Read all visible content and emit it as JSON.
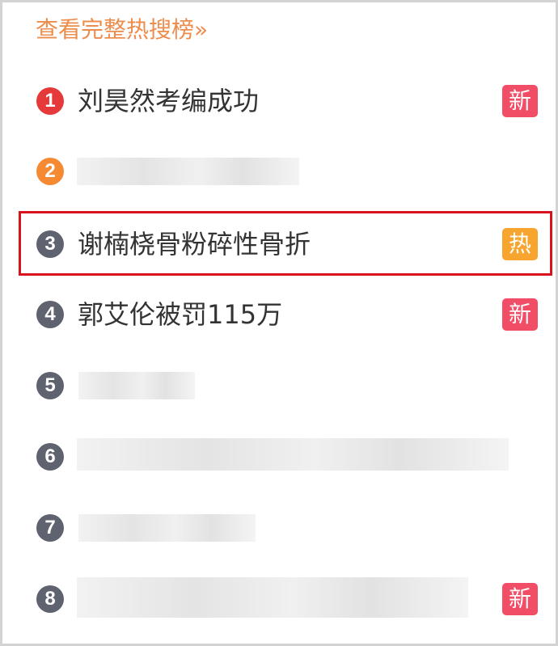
{
  "header": {
    "link_text": "查看完整热搜榜»"
  },
  "colors": {
    "header_link": "#ec8d4d",
    "rank_1": "#e63a3a",
    "rank_2": "#f58a32",
    "rank_other": "#5f6370",
    "badge_new": "#f24d67",
    "badge_hot": "#f7a52f",
    "highlight_border": "#d9141f"
  },
  "list": [
    {
      "rank": "1",
      "title": "刘昊然考编成功",
      "badge": "新",
      "badge_type": "new"
    },
    {
      "rank": "2",
      "title": "",
      "badge": "",
      "badge_type": ""
    },
    {
      "rank": "3",
      "title": "谢楠桡骨粉碎性骨折",
      "badge": "热",
      "badge_type": "hot"
    },
    {
      "rank": "4",
      "title": "郭艾伦被罚115万",
      "badge": "新",
      "badge_type": "new"
    },
    {
      "rank": "5",
      "title": "",
      "badge": "",
      "badge_type": ""
    },
    {
      "rank": "6",
      "title": "",
      "badge": "",
      "badge_type": ""
    },
    {
      "rank": "7",
      "title": "",
      "badge": "",
      "badge_type": ""
    },
    {
      "rank": "8",
      "title": "",
      "badge": "新",
      "badge_type": "new"
    }
  ]
}
